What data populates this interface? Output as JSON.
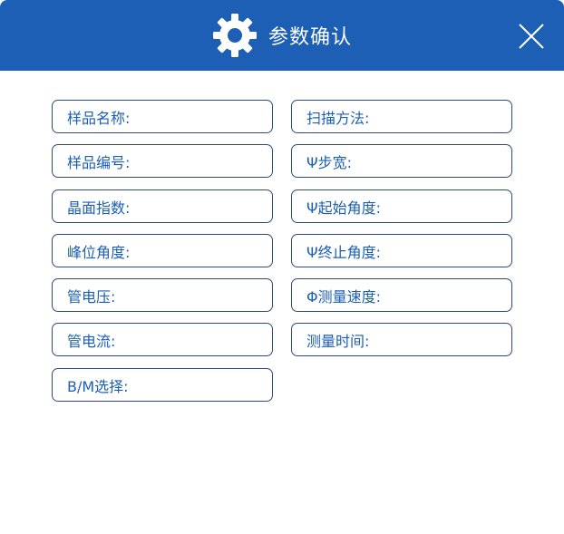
{
  "header": {
    "title": "参数确认",
    "icon": "gear-icon",
    "close_icon": "close-icon",
    "background_color": "#1c5fb5"
  },
  "fields": {
    "left": [
      "样品名称:",
      "样品编号:",
      "晶面指数:",
      "峰位角度:",
      "管电压:",
      "管电流:",
      "B/M选择:"
    ],
    "right": [
      "扫描方法:",
      "Ψ步宽:",
      "Ψ起始角度:",
      "Ψ终止角度:",
      "Φ测量速度:",
      "测量时间:"
    ]
  }
}
